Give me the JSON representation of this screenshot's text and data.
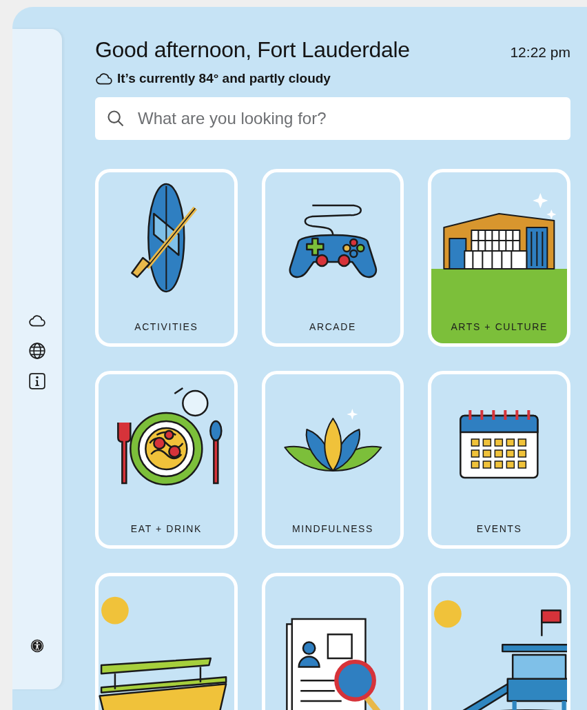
{
  "header": {
    "greeting": "Good afternoon, Fort Lauderdale",
    "time": "12:22 pm",
    "weather": "It’s currently 84° and partly cloudy"
  },
  "search": {
    "placeholder": "What are you looking for?"
  },
  "tiles": [
    {
      "label": "ACTIVITIES",
      "kind": "paddleboard"
    },
    {
      "label": "ARCADE",
      "kind": "gamepad"
    },
    {
      "label": "ARTS + CULTURE",
      "kind": "building"
    },
    {
      "label": "EAT + DRINK",
      "kind": "plate"
    },
    {
      "label": "MINDFULNESS",
      "kind": "lotus"
    },
    {
      "label": "EVENTS",
      "kind": "calendar"
    },
    {
      "kind": "boat"
    },
    {
      "kind": "document"
    },
    {
      "kind": "lifeguard"
    }
  ]
}
